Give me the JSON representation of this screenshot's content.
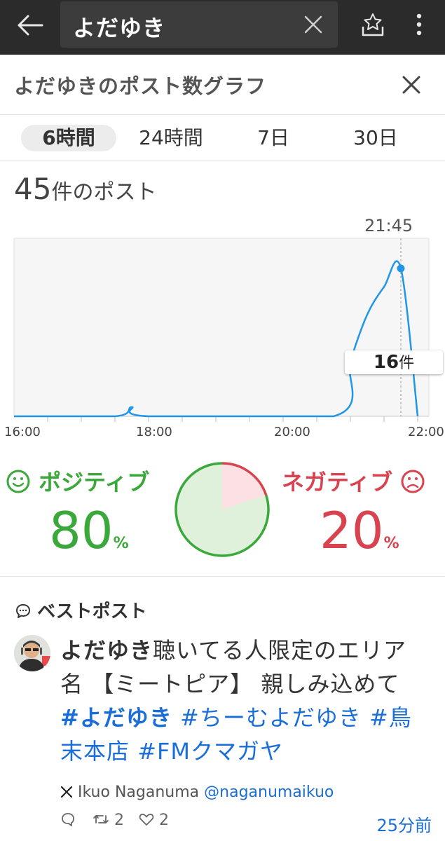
{
  "search": {
    "query": "よだゆき"
  },
  "panel": {
    "title": "よだゆきのポスト数グラフ"
  },
  "tabs": [
    {
      "label": "6時間",
      "active": true
    },
    {
      "label": "24時間",
      "active": false
    },
    {
      "label": "7日",
      "active": false
    },
    {
      "label": "30日",
      "active": false
    }
  ],
  "summary": {
    "count": "45",
    "unit": "件のポスト"
  },
  "chart_data": {
    "type": "line",
    "x_ticks": [
      "16:00",
      "18:00",
      "20:00",
      "22:00"
    ],
    "xlim": [
      "16:00",
      "22:10"
    ],
    "highlight": {
      "time": "21:45",
      "value": "16",
      "unit": "件"
    },
    "series": [
      {
        "x": [
          "16:00",
          "17:30",
          "17:45",
          "18:00",
          "20:45",
          "21:00",
          "21:15",
          "21:30",
          "21:45",
          "22:00"
        ],
        "values": [
          0,
          0,
          1,
          0,
          0,
          6,
          11,
          14,
          16,
          0
        ]
      }
    ],
    "colors": {
      "line": "#2196e8",
      "grid": "#e2e2e2",
      "plot_bg": "#f6f6f6"
    }
  },
  "sentiment": {
    "positive": {
      "label": "ポジティブ",
      "value": "80",
      "unit": "%",
      "color": "#3aa83a"
    },
    "negative": {
      "label": "ネガティブ",
      "value": "20",
      "unit": "%",
      "color": "#d9434f"
    }
  },
  "best_post": {
    "header": "ベストポスト",
    "user": "よだゆき",
    "text": "聴いてる人限定のエリア名 【ミートピア】 親しみ込めて ",
    "hashtags": [
      "#よだゆき",
      "#ちーむよだゆき",
      "#鳥末本店",
      "#FMクマガヤ"
    ],
    "author_name": "Ikuo Naganuma",
    "author_handle": "@naganumaikuo",
    "retweets": "2",
    "likes": "2",
    "time_ago": "25分前"
  },
  "icons": {
    "back": "arrow-left-icon",
    "clear": "close-icon",
    "save": "save-search-icon",
    "more": "more-vert-icon",
    "reply": "reply-icon",
    "retweet": "retweet-icon",
    "like": "heart-icon"
  }
}
